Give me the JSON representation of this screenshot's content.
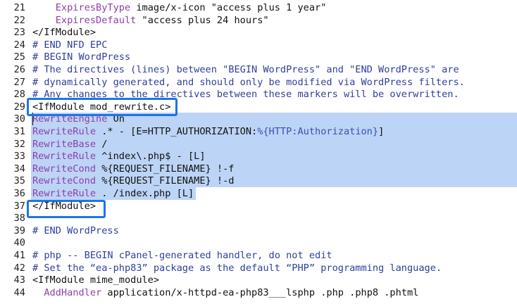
{
  "editor": {
    "lines": [
      {
        "num": "21",
        "segs": [
          {
            "t": "    ",
            "c": "plain"
          },
          {
            "t": "ExpiresByType",
            "c": "kw"
          },
          {
            "t": " image/x-icon \"access plus 1 year\"",
            "c": "plain"
          }
        ]
      },
      {
        "num": "22",
        "segs": [
          {
            "t": "    ",
            "c": "plain"
          },
          {
            "t": "ExpiresDefault",
            "c": "kw"
          },
          {
            "t": " \"access plus 24 hours\"",
            "c": "plain"
          }
        ]
      },
      {
        "num": "23",
        "segs": [
          {
            "t": "</IfModule>",
            "c": "plain"
          }
        ]
      },
      {
        "num": "24",
        "segs": [
          {
            "t": "# END NFD EPC",
            "c": "com"
          }
        ]
      },
      {
        "num": "25",
        "segs": [
          {
            "t": "# BEGIN WordPress",
            "c": "com"
          }
        ]
      },
      {
        "num": "26",
        "segs": [
          {
            "t": "# The directives (lines) between \"BEGIN WordPress\" and \"END WordPress\" are",
            "c": "com"
          }
        ]
      },
      {
        "num": "27",
        "segs": [
          {
            "t": "# dynamically generated, and should only be modified via WordPress filters.",
            "c": "com"
          }
        ]
      },
      {
        "num": "28",
        "segs": [
          {
            "t": "# Any changes to the directives between these markers will be overwritten.",
            "c": "com"
          }
        ]
      },
      {
        "num": "29",
        "segs": [
          {
            "t": "<IfModule mod_rewrite.c>",
            "c": "plain"
          }
        ]
      },
      {
        "num": "30",
        "segs": [
          {
            "t": "RewriteEngine",
            "c": "kw"
          },
          {
            "t": " On",
            "c": "plain"
          }
        ]
      },
      {
        "num": "31",
        "segs": [
          {
            "t": "RewriteRule",
            "c": "kw"
          },
          {
            "t": " .* - [E=HTTP_AUTHORIZATION:",
            "c": "plain"
          },
          {
            "t": "%{HTTP:Authorization}",
            "c": "var"
          },
          {
            "t": "]",
            "c": "plain"
          }
        ]
      },
      {
        "num": "32",
        "segs": [
          {
            "t": "RewriteBase",
            "c": "kw"
          },
          {
            "t": " /",
            "c": "plain"
          }
        ]
      },
      {
        "num": "33",
        "segs": [
          {
            "t": "RewriteRule",
            "c": "kw"
          },
          {
            "t": " ^index\\.php$ - [L]",
            "c": "plain"
          }
        ]
      },
      {
        "num": "34",
        "segs": [
          {
            "t": "RewriteCond",
            "c": "kw"
          },
          {
            "t": " %{REQUEST_FILENAME} !-f",
            "c": "plain"
          }
        ]
      },
      {
        "num": "35",
        "segs": [
          {
            "t": "RewriteCond",
            "c": "kw"
          },
          {
            "t": " %{REQUEST_FILENAME} !-d",
            "c": "plain"
          }
        ]
      },
      {
        "num": "36",
        "segs": [
          {
            "t": "RewriteRule",
            "c": "kw"
          },
          {
            "t": " . /index.php [L]",
            "c": "plain"
          }
        ]
      },
      {
        "num": "37",
        "segs": [
          {
            "t": "</IfModule>",
            "c": "plain"
          }
        ]
      },
      {
        "num": "38",
        "segs": [
          {
            "t": "",
            "c": "plain"
          }
        ]
      },
      {
        "num": "39",
        "segs": [
          {
            "t": "# END WordPress",
            "c": "com"
          }
        ]
      },
      {
        "num": "40",
        "segs": [
          {
            "t": "",
            "c": "plain"
          }
        ]
      },
      {
        "num": "41",
        "segs": [
          {
            "t": "# php -- BEGIN cPanel-generated handler, do not edit",
            "c": "com"
          }
        ]
      },
      {
        "num": "42",
        "segs": [
          {
            "t": "# Set the “ea-php83” package as the default “PHP” programming language.",
            "c": "com"
          }
        ]
      },
      {
        "num": "43",
        "segs": [
          {
            "t": "<IfModule mime_module>",
            "c": "plain"
          }
        ]
      },
      {
        "num": "44",
        "segs": [
          {
            "t": "  ",
            "c": "plain"
          },
          {
            "t": "AddHandler",
            "c": "kw"
          },
          {
            "t": " application/x-httpd-ea-php83___lsphp .php .php8 .phtml",
            "c": "plain"
          }
        ]
      }
    ]
  },
  "colors": {
    "selection": "#bcd4f6",
    "highlight_border": "#1d74e8",
    "directive": "#8f3fa8",
    "comment": "#2f3f9a"
  }
}
